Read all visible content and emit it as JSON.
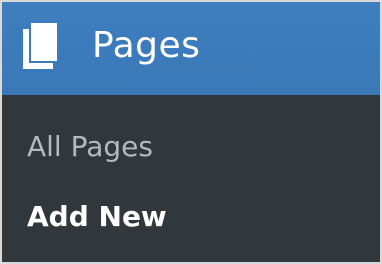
{
  "menu": {
    "icon": "pages-icon",
    "title": "Pages",
    "header_color": "#3a78b8",
    "items": [
      {
        "label": "All Pages",
        "state": "inactive"
      },
      {
        "label": "Add New",
        "state": "current"
      }
    ]
  },
  "colors": {
    "sidebar_background": "#32373c",
    "inactive_text": "#b4b9be",
    "active_text": "#ffffff"
  }
}
